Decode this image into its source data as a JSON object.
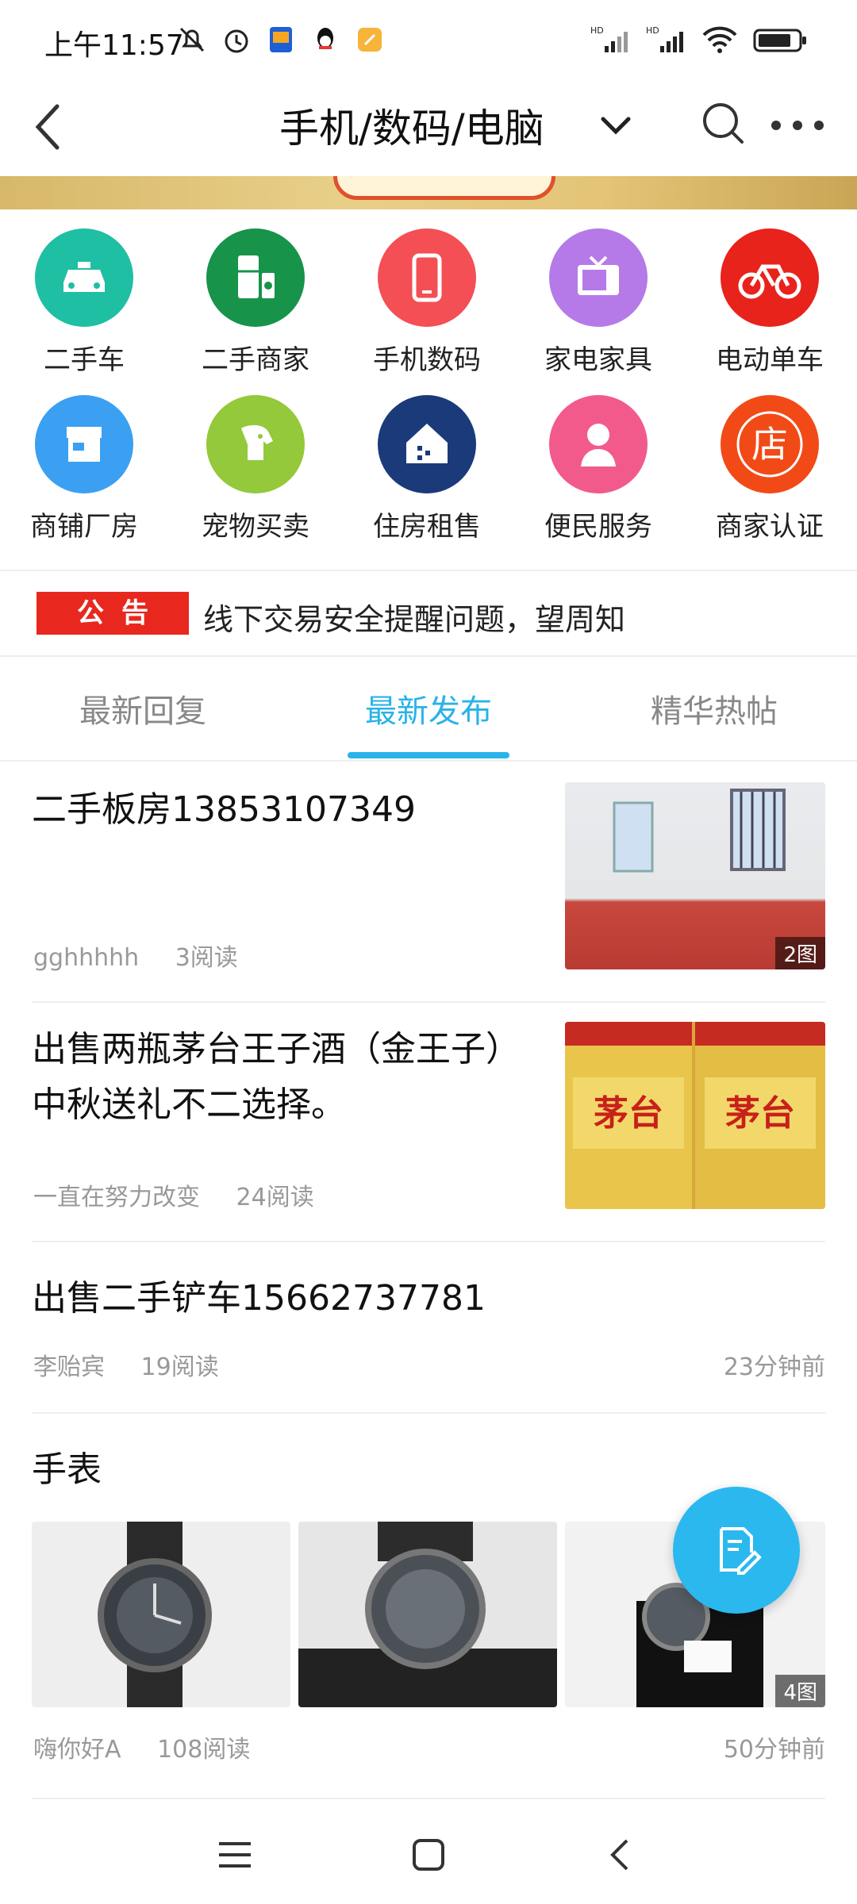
{
  "status_bar": {
    "time": "上午11:57",
    "battery_icon": "battery-icon",
    "wifi_icon": "wifi-icon"
  },
  "header": {
    "title": "手机/数码/电脑",
    "back_icon": "back-icon",
    "search_icon": "search-icon",
    "more_icon": "more-icon"
  },
  "categories": [
    {
      "label": "二手车",
      "icon": "car-icon",
      "color": "#1fbfa4"
    },
    {
      "label": "二手商家",
      "icon": "fridge-icon",
      "color": "#17934a"
    },
    {
      "label": "手机数码",
      "icon": "phone-icon",
      "color": "#f34f55"
    },
    {
      "label": "家电家具",
      "icon": "tv-icon",
      "color": "#b57ae8"
    },
    {
      "label": "电动单车",
      "icon": "bike-icon",
      "color": "#e8231c"
    },
    {
      "label": "商铺厂房",
      "icon": "shop-icon",
      "color": "#3ba0f2"
    },
    {
      "label": "宠物买卖",
      "icon": "dog-icon",
      "color": "#93c93a"
    },
    {
      "label": "住房租售",
      "icon": "house-icon",
      "color": "#1b3a7a"
    },
    {
      "label": "便民服务",
      "icon": "person-icon",
      "color": "#f25a8c"
    },
    {
      "label": "商家认证",
      "icon": "store-icon",
      "color": "#f24a17"
    }
  ],
  "notice": {
    "tag": "公告",
    "text": "线下交易安全提醒问题，望周知"
  },
  "tabs": [
    {
      "label": "最新回复",
      "active": false
    },
    {
      "label": "最新发布",
      "active": true
    },
    {
      "label": "精华热帖",
      "active": false
    }
  ],
  "posts": [
    {
      "title": "二手板房13853107349",
      "author": "gghhhhh",
      "reads": "3阅读",
      "badge": "2图"
    },
    {
      "title": "出售两瓶茅台王子酒（金王子）中秋送礼不二选择。",
      "author": "一直在努力改变",
      "reads": "24阅读"
    },
    {
      "title": "出售二手铲车15662737781",
      "author": "李贻宾",
      "reads": "19阅读",
      "time": "23分钟前"
    },
    {
      "title": "手表",
      "author": "嗨你好A",
      "reads": "108阅读",
      "time": "50分钟前",
      "badge": "4图"
    }
  ],
  "fab": {
    "icon": "edit-icon"
  },
  "nav_bar": {
    "menu_icon": "menu-icon",
    "home_icon": "home-icon",
    "back_icon": "nav-back-icon"
  }
}
